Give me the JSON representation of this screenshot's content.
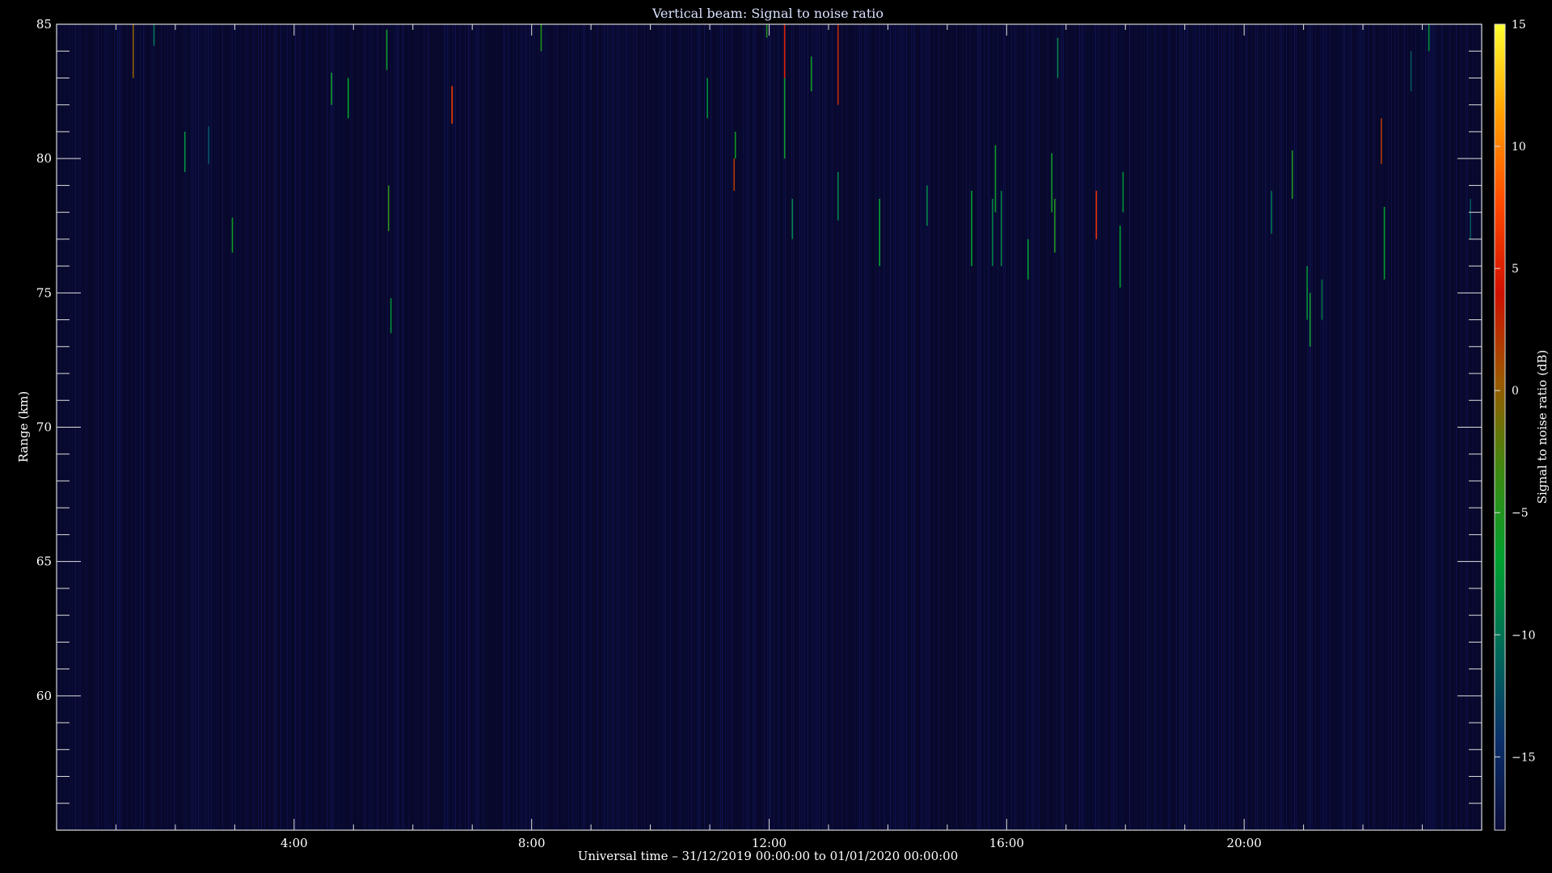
{
  "chart_data": {
    "type": "heatmap",
    "title": "Vertical beam: Signal to noise ratio",
    "xlabel": "Universal time – 31/12/2019 00:00:00 to 01/01/2020 00:00:00",
    "ylabel": "Range (km)",
    "colorbar_label": "Signal to noise ratio (dB)",
    "xlim_hours": [
      0,
      24
    ],
    "ylim_km": [
      55,
      85
    ],
    "x_ticks": [
      {
        "value": 4,
        "label": "4:00"
      },
      {
        "value": 8,
        "label": "8:00"
      },
      {
        "value": 12,
        "label": "12:00"
      },
      {
        "value": 16,
        "label": "16:00"
      },
      {
        "value": 20,
        "label": "20:00"
      }
    ],
    "y_ticks": [
      {
        "value": 60,
        "label": "60"
      },
      {
        "value": 65,
        "label": "65"
      },
      {
        "value": 70,
        "label": "70"
      },
      {
        "value": 75,
        "label": "75"
      },
      {
        "value": 80,
        "label": "80"
      },
      {
        "value": 85,
        "label": "85"
      }
    ],
    "colorbar_range_db": [
      -18,
      15
    ],
    "colorbar_ticks": [
      {
        "value": 15,
        "label": "15"
      },
      {
        "value": 10,
        "label": "10"
      },
      {
        "value": 5,
        "label": "5"
      },
      {
        "value": 0,
        "label": "0"
      },
      {
        "value": -5,
        "label": "−5"
      },
      {
        "value": -10,
        "label": "−10"
      },
      {
        "value": -15,
        "label": "−15"
      }
    ],
    "colormap": [
      "#0b0b3a",
      "#0a2f6a",
      "#006a5a",
      "#00a030",
      "#3c8a10",
      "#9a5a00",
      "#d01000",
      "#ff4a00",
      "#ffa000",
      "#ffff30"
    ],
    "background_snr_db": -17,
    "events": [
      {
        "t": 1.28,
        "r0": 83.0,
        "r1": 85.0,
        "snr": 0
      },
      {
        "t": 1.63,
        "r0": 84.2,
        "r1": 85.0,
        "snr": -10
      },
      {
        "t": 2.15,
        "r0": 79.5,
        "r1": 81.0,
        "snr": -8
      },
      {
        "t": 2.55,
        "r0": 79.8,
        "r1": 81.2,
        "snr": -12
      },
      {
        "t": 2.95,
        "r0": 76.5,
        "r1": 77.8,
        "snr": -6
      },
      {
        "t": 4.62,
        "r0": 82.0,
        "r1": 83.2,
        "snr": -6
      },
      {
        "t": 4.9,
        "r0": 81.5,
        "r1": 83.0,
        "snr": -7
      },
      {
        "t": 5.58,
        "r0": 77.3,
        "r1": 79.0,
        "snr": -4
      },
      {
        "t": 5.62,
        "r0": 73.5,
        "r1": 74.8,
        "snr": -8
      },
      {
        "t": 5.55,
        "r0": 83.3,
        "r1": 84.8,
        "snr": -6
      },
      {
        "t": 6.65,
        "r0": 81.3,
        "r1": 82.7,
        "snr": 7
      },
      {
        "t": 8.15,
        "r0": 84.0,
        "r1": 85.0,
        "snr": -5
      },
      {
        "t": 10.95,
        "r0": 81.5,
        "r1": 83.0,
        "snr": -8
      },
      {
        "t": 11.4,
        "r0": 78.8,
        "r1": 80.0,
        "snr": 2
      },
      {
        "t": 11.42,
        "r0": 80.0,
        "r1": 81.0,
        "snr": -6
      },
      {
        "t": 11.95,
        "r0": 84.5,
        "r1": 85.0,
        "snr": -5
      },
      {
        "t": 12.25,
        "r0": 83.0,
        "r1": 85.0,
        "snr": 5
      },
      {
        "t": 12.25,
        "r0": 80.0,
        "r1": 83.0,
        "snr": -6
      },
      {
        "t": 12.38,
        "r0": 77.0,
        "r1": 78.5,
        "snr": -9
      },
      {
        "t": 12.7,
        "r0": 82.5,
        "r1": 83.8,
        "snr": -6
      },
      {
        "t": 13.15,
        "r0": 82.0,
        "r1": 85.0,
        "snr": 3
      },
      {
        "t": 13.15,
        "r0": 77.7,
        "r1": 79.5,
        "snr": -9
      },
      {
        "t": 13.85,
        "r0": 76.0,
        "r1": 78.5,
        "snr": -7
      },
      {
        "t": 14.65,
        "r0": 77.5,
        "r1": 79.0,
        "snr": -9
      },
      {
        "t": 15.4,
        "r0": 76.0,
        "r1": 78.8,
        "snr": -7
      },
      {
        "t": 15.75,
        "r0": 76.0,
        "r1": 78.5,
        "snr": -9
      },
      {
        "t": 15.8,
        "r0": 78.0,
        "r1": 80.5,
        "snr": -6
      },
      {
        "t": 15.9,
        "r0": 76.0,
        "r1": 78.8,
        "snr": -9
      },
      {
        "t": 16.35,
        "r0": 75.5,
        "r1": 77.0,
        "snr": -7
      },
      {
        "t": 16.75,
        "r0": 78.0,
        "r1": 80.2,
        "snr": -6
      },
      {
        "t": 16.8,
        "r0": 76.5,
        "r1": 78.5,
        "snr": -5
      },
      {
        "t": 16.85,
        "r0": 83.0,
        "r1": 84.5,
        "snr": -9
      },
      {
        "t": 17.5,
        "r0": 77.0,
        "r1": 78.8,
        "snr": 6
      },
      {
        "t": 17.9,
        "r0": 75.2,
        "r1": 77.5,
        "snr": -7
      },
      {
        "t": 17.95,
        "r0": 78.0,
        "r1": 79.5,
        "snr": -8
      },
      {
        "t": 20.45,
        "r0": 77.2,
        "r1": 78.8,
        "snr": -10
      },
      {
        "t": 20.8,
        "r0": 78.5,
        "r1": 80.3,
        "snr": -5
      },
      {
        "t": 21.05,
        "r0": 74.0,
        "r1": 76.0,
        "snr": -8
      },
      {
        "t": 21.1,
        "r0": 73.0,
        "r1": 75.0,
        "snr": -6
      },
      {
        "t": 21.3,
        "r0": 74.0,
        "r1": 75.5,
        "snr": -10
      },
      {
        "t": 22.3,
        "r0": 79.8,
        "r1": 81.5,
        "snr": 2
      },
      {
        "t": 22.35,
        "r0": 75.5,
        "r1": 78.2,
        "snr": -7
      },
      {
        "t": 22.8,
        "r0": 82.5,
        "r1": 84.0,
        "snr": -12
      },
      {
        "t": 23.1,
        "r0": 84.0,
        "r1": 85.0,
        "snr": -8
      },
      {
        "t": 23.8,
        "r0": 77.0,
        "r1": 78.5,
        "snr": -12
      }
    ]
  }
}
